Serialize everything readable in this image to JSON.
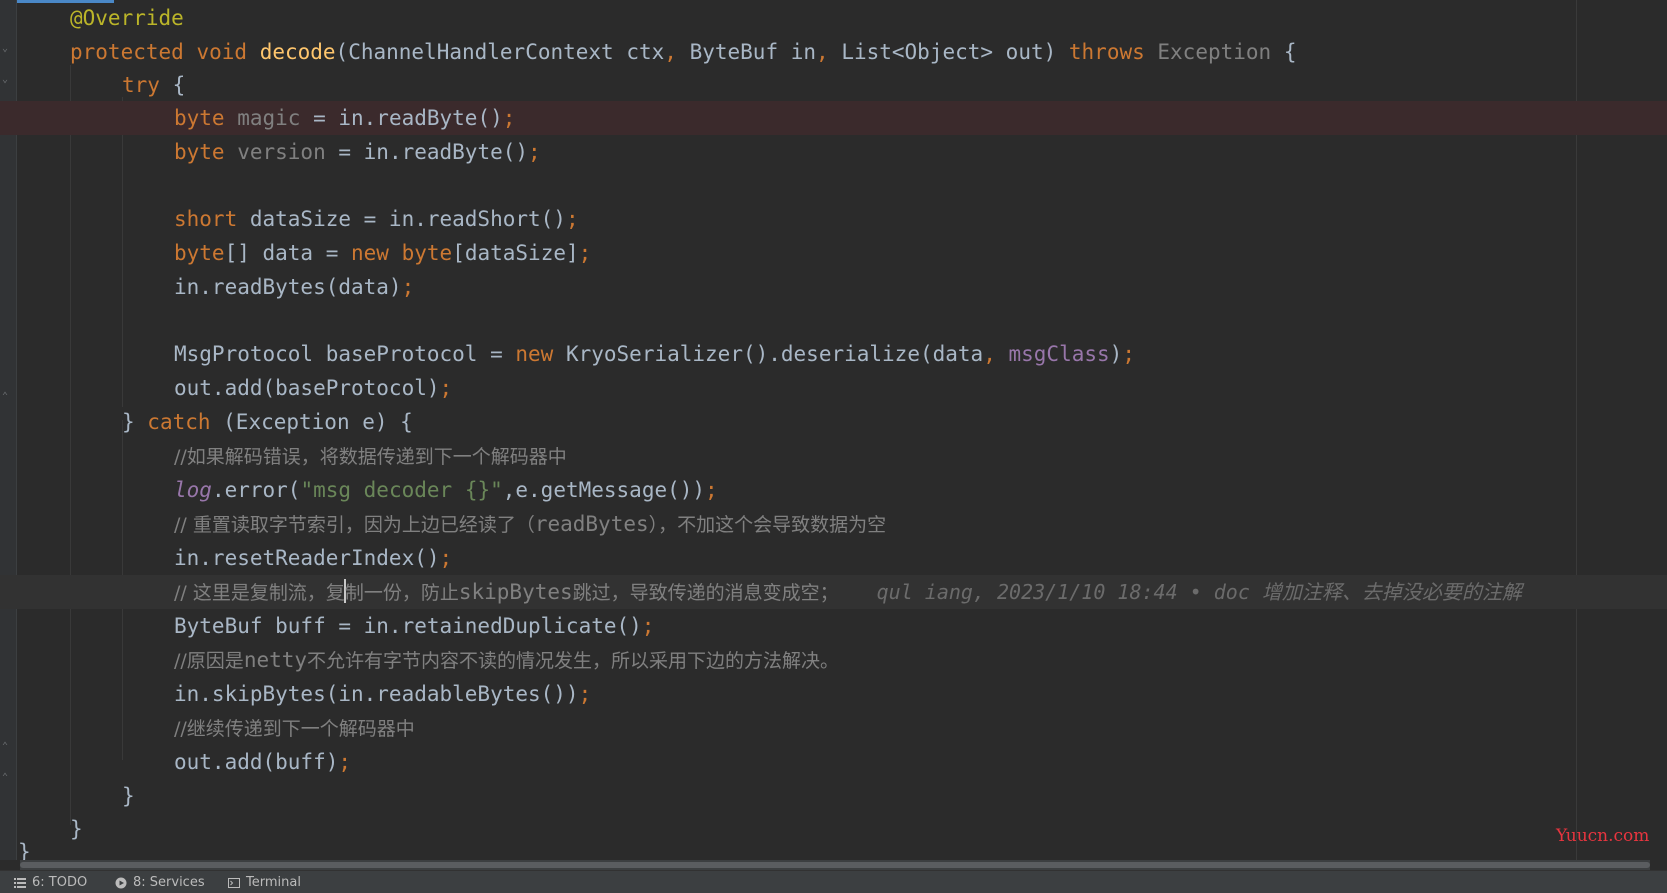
{
  "code": {
    "override": "@Override",
    "sig_protected": "protected",
    "sig_void": "void",
    "sig_method": "decode",
    "sig_params_1": "(ChannelHandlerContext ctx",
    "comma": ",",
    "sig_params_2": " ByteBuf in",
    "sig_params_3": " List<Object> out) ",
    "sig_throws": "throws",
    "sig_exception": " Exception",
    "sig_brace": " {",
    "try_kw": "try",
    "brace_open": " {",
    "byte_kw": "byte",
    "magic_var": " magic",
    "read_byte_call": " = in.readByte()",
    "semicolon": ";",
    "version_var": " version",
    "short_kw": "short",
    "data_size_stmt": " dataSize = in.readShort()",
    "byte_arr": "[] data = ",
    "new_kw": "new",
    "space": " ",
    "byte_arr_size": "[dataSize]",
    "read_bytes_stmt": "in.readBytes(data)",
    "msg_protocol_decl": "MsgProtocol baseProtocol = ",
    "kryo_call": " KryoSerializer().deserialize(data",
    "msg_class": "msgClass",
    "close_paren": ")",
    "out_add_base": "out.add(baseProtocol)",
    "catch_close_brace": "} ",
    "catch_kw": "catch",
    "catch_rest": " (Exception e) {",
    "comment_1": "//如果解码错误，将数据传递到下一个解码器中",
    "log_ident": "log",
    "log_error_open": ".error(",
    "log_string": "\"msg decoder {}\"",
    "log_error_rest": ",e.getMessage())",
    "comment_2_a": "// 重置读取字节索引，因为上边已经读了（",
    "comment_2_b": "readBytes",
    "comment_2_c": "），不加这个会导致数据为空",
    "reset_stmt": "in.resetReaderIndex()",
    "comment_3_a": "// 这里是复制流，复",
    "comment_3_b": "制一份，防止",
    "comment_3_c": "skipBytes",
    "comment_3_d": "跳过，导致传递的消息变成空；",
    "blame_meta": "qul iang, 2023/1/10 18:44 • doc ",
    "blame_msg": "增加注释、去掉没必要的注解",
    "buff_stmt": "ByteBuf buff = in.retainedDuplicate()",
    "comment_4_a": "//原因是",
    "comment_4_b": "netty",
    "comment_4_c": "不允许有字节内容不读的情况发生，所以采用下边的方法解决。",
    "skip_stmt": "in.skipBytes(in.readableBytes())",
    "comment_5": "//继续传递到下一个解码器中",
    "out_add_buff": "out.add(buff)",
    "close_brace": "}"
  },
  "statusbar": {
    "todo": "6: TODO",
    "services": "8: Services",
    "terminal": "Terminal"
  },
  "watermark": "Yuucn.com",
  "colors": {
    "background": "#2b2b2b",
    "keyword": "#cc7832",
    "annotation": "#bbb529",
    "method": "#ffc66d",
    "string": "#6a8759",
    "field": "#9876aa",
    "comment": "#808080",
    "error_line": "#3b2a2c",
    "watermark": "#e8353f"
  }
}
